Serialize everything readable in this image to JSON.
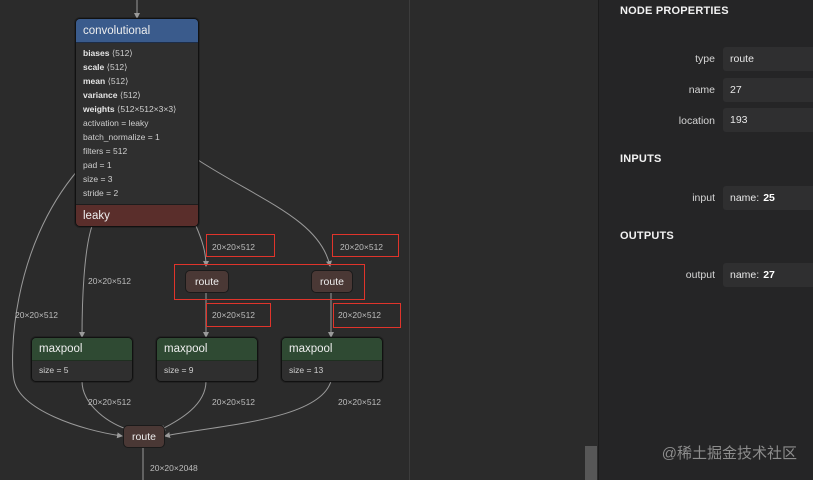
{
  "graph": {
    "conv": {
      "title": "convolutional",
      "inits": [
        {
          "name": "biases",
          "shape": "⟨512⟩"
        },
        {
          "name": "scale",
          "shape": "⟨512⟩"
        },
        {
          "name": "mean",
          "shape": "⟨512⟩"
        },
        {
          "name": "variance",
          "shape": "⟨512⟩"
        },
        {
          "name": "weights",
          "shape": "⟨512×512×3×3⟩"
        }
      ],
      "attrs": [
        "activation = leaky",
        "batch_normalize = 1",
        "filters = 512",
        "pad = 1",
        "size = 3",
        "stride = 2"
      ],
      "activation": "leaky"
    },
    "route_label": "route",
    "maxpool_label": "maxpool",
    "maxpool_attrs": [
      "size = 5",
      "size = 9",
      "size = 13"
    ],
    "edge_labels": {
      "left_outer": "20×20×512",
      "left_inner": "20×20×512",
      "mid_top": "20×20×512",
      "right_top": "20×20×512",
      "mid_bottom": "20×20×512",
      "right_bottom": "20×20×512",
      "pool1_out": "20×20×512",
      "pool2_out": "20×20×512",
      "pool3_out": "20×20×512",
      "final_out": "20×20×2048"
    }
  },
  "panel": {
    "title": "NODE PROPERTIES",
    "props": [
      {
        "key": "type",
        "value": "route"
      },
      {
        "key": "name",
        "value": "27"
      },
      {
        "key": "location",
        "value": "193"
      }
    ],
    "inputs_title": "INPUTS",
    "input": {
      "key": "input",
      "prefix": "name:",
      "value": "25"
    },
    "outputs_title": "OUTPUTS",
    "output": {
      "key": "output",
      "prefix": "name:",
      "value": "27"
    }
  },
  "watermark": "@稀土掘金技术社区",
  "colors": {
    "conv_header": "#3a5b8c",
    "leaky_header": "#5a2e2b",
    "maxpool_header": "#2f4a33",
    "route_node": "#4a3835",
    "highlight": "#e0342b"
  }
}
